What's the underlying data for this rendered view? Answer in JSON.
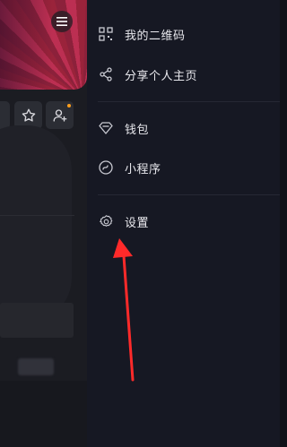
{
  "drawer": {
    "items": [
      {
        "label": "我的二维码",
        "icon": "qr-code-icon"
      },
      {
        "label": "分享个人主页",
        "icon": "share-icon"
      },
      {
        "label": "钱包",
        "icon": "wallet-icon"
      },
      {
        "label": "小程序",
        "icon": "mini-program-icon"
      },
      {
        "label": "设置",
        "icon": "settings-gear-icon"
      }
    ]
  },
  "profile": {
    "icons": [
      "menu-icon",
      "star-icon",
      "add-friend-icon"
    ]
  },
  "colors": {
    "drawer_bg": "#161823",
    "text": "#e9e9ee",
    "arrow": "#ff2a2a",
    "notification_dot": "#ff9f1c"
  }
}
